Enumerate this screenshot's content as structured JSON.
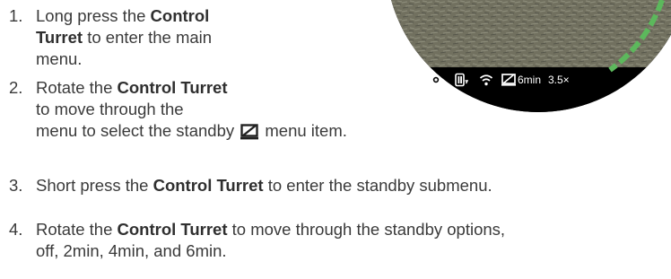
{
  "steps": [
    {
      "number": "1.",
      "lines": [
        {
          "text": "Long press the ",
          "bold": "Control"
        },
        {
          "bold": "Turret",
          "text": " to enter the main"
        },
        {
          "text": "menu."
        }
      ]
    },
    {
      "number": "2.",
      "lines": [
        {
          "text": "Rotate the ",
          "bold": "Control Turret"
        },
        {
          "text": "to move through the"
        },
        {
          "text": "menu to select the standby",
          "icon": "standby-icon",
          "after": "menu item."
        }
      ]
    },
    {
      "number": "3.",
      "lines": [
        {
          "text": "Short press the ",
          "bold": "Control Turret",
          "after": " to enter the standby submenu."
        }
      ]
    },
    {
      "number": "4.",
      "lines": [
        {
          "text": "Rotate the ",
          "bold": "Control Turret",
          "after": " to move through the standby options,"
        },
        {
          "text": "off, 2min, 4min, and 6min."
        }
      ]
    }
  ],
  "scope_status": {
    "icons": [
      "eye-icon",
      "battery-icon",
      "wifi-icon",
      "standby-icon"
    ],
    "standby_value": "6min",
    "zoom": "3.5×"
  },
  "colors": {
    "text": "#3a3a3a",
    "scope_ring": "#000000",
    "ring_dash": "#5cb85c",
    "ground": "#6f6f5f"
  }
}
